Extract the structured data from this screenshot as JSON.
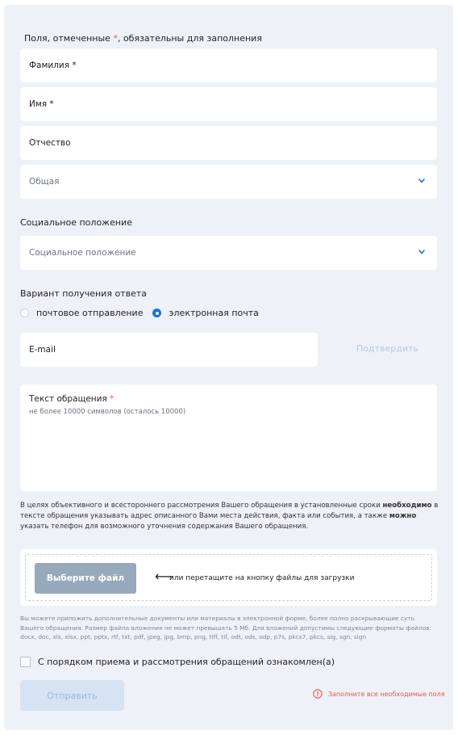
{
  "form": {
    "required_note_prefix": "Поля, отмеченные ",
    "required_mark": "*",
    "required_note_suffix": ", обязательны для заполнения",
    "fields": {
      "last_name": "Фамилия *",
      "first_name": "Имя *",
      "patronymic": "Отчество",
      "category_select": "Общая"
    },
    "social": {
      "heading": "Социальное положение",
      "placeholder": "Социальное положение"
    },
    "reply": {
      "heading": "Вариант получения ответа",
      "options": [
        "почтовое отправление",
        "электронная почта"
      ],
      "selected": "электронная почта",
      "email_placeholder": "E-mail",
      "confirm_label": "Подтвердить"
    },
    "message": {
      "label": "Текст обращения",
      "hint": "не более 10000 символов (осталось 10000)"
    },
    "info": {
      "part1": "В целях объективного и всестороннего рассмотрения Вашего обращения в установленные сроки ",
      "bold1": "необходимо",
      "part2": " в тексте обращения указывать адрес описанного Вами места действия, факта или события, а также ",
      "bold2": "можно",
      "part3": " указать телефон для возможного уточнения содержания Вашего обращения."
    },
    "upload": {
      "button_label": "Выберите файл",
      "arrow": "⟵",
      "drag_text": "или перетащите на кнопку файлы для загрузки",
      "note": "Вы можете приложить дополнительные документы или материалы в электронной форме, более полно раскрывающие суть Вашего обращения. Размер файла вложения не может превышать 5 Мб. Для вложений допустимы следующие форматы файлов: docx, doc, xls, xlsx, ppt, pptx, rtf, txt, pdf, jpeg, jpg, bmp, png, tiff, tif, odt, ods, odp, p7s, pkcs7, pkcs, sig, sgn, sign"
    },
    "agree_label": "С порядком приема и рассмотрения обращений ознакомлен(а)",
    "submit_label": "Отправить",
    "error_text": "Заполните все необходимые поля"
  },
  "colors": {
    "panel_bg": "#eef2f8",
    "accent": "#1e6fd9",
    "required": "#e05a4e",
    "file_button": "#97a9ba",
    "submit_disabled": "#d5e3f3"
  },
  "icons": {
    "dropdown": "chevron-down-icon",
    "error": "error-circle-icon"
  }
}
